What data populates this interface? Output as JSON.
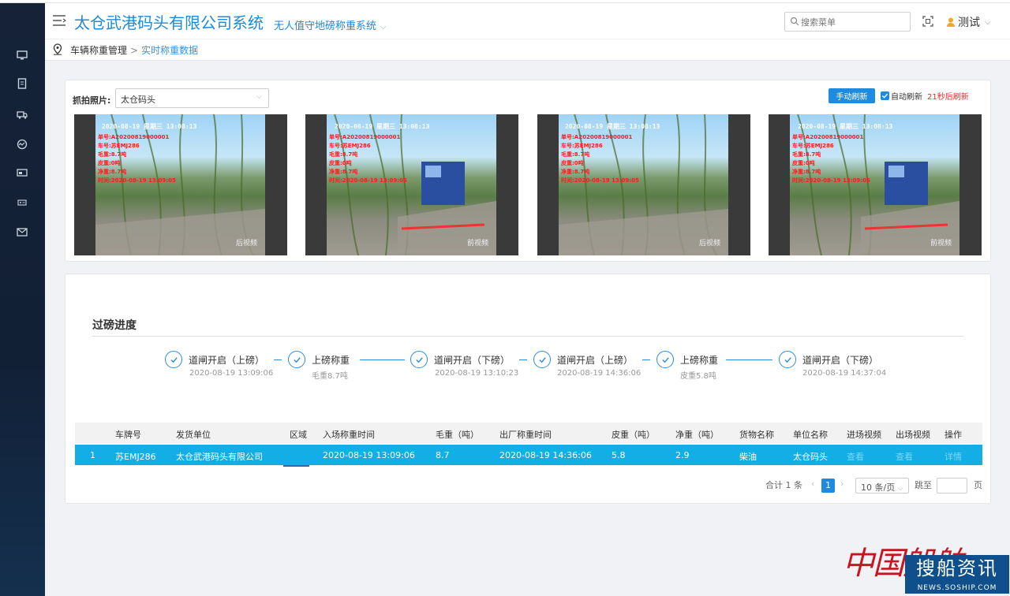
{
  "header": {
    "title": "太仓武港码头有限公司系统",
    "subsystem": "无人值守地磅称重系统",
    "search_placeholder": "搜索菜单",
    "user": "测试"
  },
  "breadcrumb": {
    "root": "车辆称重管理",
    "separator": ">",
    "current": "实时称重数据"
  },
  "sidebar": {
    "icons": [
      "monitor-icon",
      "document-icon",
      "truck-icon",
      "speedometer-icon",
      "card-icon",
      "id-card-icon",
      "mail-icon"
    ]
  },
  "capture": {
    "label": "抓拍照片:",
    "location": "太仓码头",
    "refresh_button": "手动刷新",
    "auto_refresh_label": "自动刷新",
    "countdown": "21秒后刷新",
    "photos": [
      {
        "timestamp": "2020-08-19 星期三 13:08:13",
        "lines": [
          "单号:A20200819000001",
          "车号:苏EMJ286",
          "毛重:8.7吨",
          "皮重:0吨",
          "净重:8.7吨",
          "时间:2020-08-19 13:09:05"
        ],
        "camera": "后视频"
      },
      {
        "timestamp": "2020-08-19 星期三 13:08:13",
        "lines": [
          "单号:A20200819000001",
          "车号:苏EMJ286",
          "毛重:8.7吨",
          "皮重:0吨",
          "净重:8.7吨",
          "时间:2020-08-19 13:09:05"
        ],
        "camera": "前视频"
      },
      {
        "timestamp": "2020-08-19 星期三 13:08:13",
        "lines": [
          "单号:A20200819000001",
          "车号:苏EMJ286",
          "毛重:8.7吨",
          "皮重:0吨",
          "净重:8.7吨",
          "时间:2020-08-19 13:09:05"
        ],
        "camera": "后视频"
      },
      {
        "timestamp": "2020-08-19 星期三 13:08:13",
        "lines": [
          "单号:A20200819000001",
          "车号:苏EMJ286",
          "毛重:8.7吨",
          "皮重:0吨",
          "净重:8.7吨",
          "时间:2020-08-19 13:09:05"
        ],
        "camera": "前视频"
      }
    ]
  },
  "progress": {
    "title": "过磅进度",
    "steps": [
      {
        "title": "道闸开启（上磅）",
        "sub": "2020-08-19 13:09:06"
      },
      {
        "title": "上磅称重",
        "sub": "毛重8.7吨"
      },
      {
        "title": "道闸开启（下磅）",
        "sub": "2020-08-19 13:10:23"
      },
      {
        "title": "道闸开启（上磅）",
        "sub": "2020-08-19 14:36:06"
      },
      {
        "title": "上磅称重",
        "sub": "皮重5.8吨"
      },
      {
        "title": "道闸开启（下磅）",
        "sub": "2020-08-19 14:37:04"
      }
    ]
  },
  "table": {
    "columns": [
      "车牌号",
      "发货单位",
      "区域",
      "入场称重时间",
      "毛重（吨）",
      "出厂称重时间",
      "皮重（吨）",
      "净重（吨）",
      "货物名称",
      "单位名称",
      "进场视频",
      "出场视频",
      "操作"
    ],
    "rows": [
      {
        "index": "1",
        "plate": "苏EMJ286",
        "sender": "太仓武港码头有限公司",
        "region": "",
        "in_time": "2020-08-19 13:09:06",
        "gross": "8.7",
        "out_time": "2020-08-19 14:36:06",
        "tare": "5.8",
        "net": "2.9",
        "goods": "柴油",
        "unit": "太仓码头",
        "in_video": "查看",
        "out_video": "查看",
        "action": "详情"
      }
    ]
  },
  "pagination": {
    "total": "合计 1 条",
    "prev": "‹",
    "current_page": "1",
    "next": "›",
    "page_size": "10 条/页",
    "jump_label": "跳至",
    "page_suffix": "页"
  },
  "watermark": {
    "red_text": "中国船舶",
    "box_text": "搜船资讯",
    "url": "NEWS.SOSHIP.COM"
  }
}
